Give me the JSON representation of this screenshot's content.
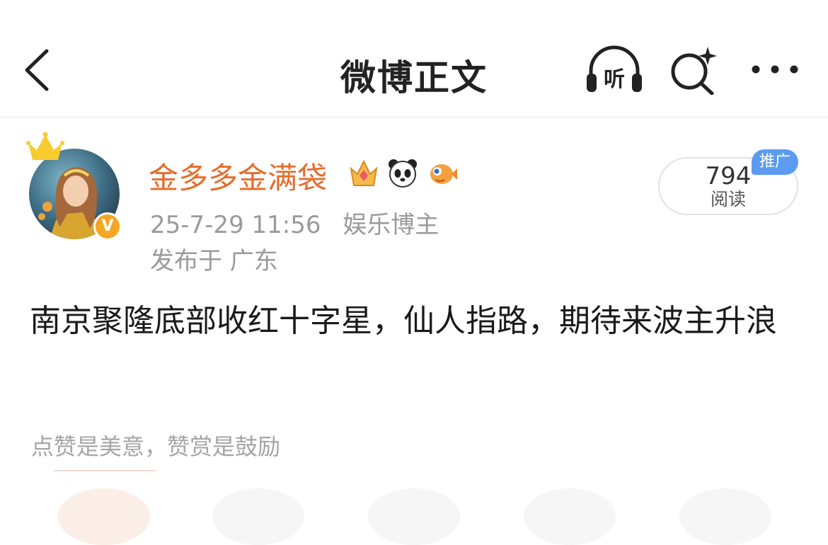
{
  "header": {
    "title": "微博正文",
    "back_icon": "chevron-left-icon",
    "listen_label": "听",
    "search_icon": "search-sparkle-icon",
    "more_icon": "more-horizontal-icon"
  },
  "author": {
    "name": "金多多金满袋",
    "verified_mark": "V",
    "badges": [
      "crown-badge-icon",
      "panda-badge-icon",
      "pufferfish-badge-icon"
    ],
    "time": "25-7-29 11:56",
    "category": "娱乐博主",
    "location": "发布于 广东"
  },
  "reads": {
    "count": "794",
    "label": "阅读",
    "promo": "推广"
  },
  "post": {
    "text": "南京聚隆底部收红十字星，仙人指路，期待来波主升浪"
  },
  "reward": {
    "text": "点赞是美意，赞赏是鼓励"
  },
  "colors": {
    "author_name": "#e86b2a",
    "meta": "#9a9a9a",
    "promo_bg": "#5b9cf0",
    "verified": "#f6a623"
  }
}
